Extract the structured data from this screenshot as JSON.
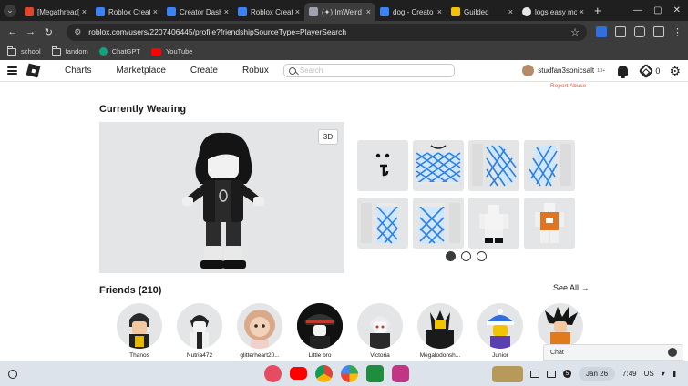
{
  "browser": {
    "tabs": [
      {
        "title": "[Megathread]",
        "favicon_color": "#e0452c",
        "active": false
      },
      {
        "title": "Roblox Creat",
        "favicon_color": "#3b82f6",
        "active": false
      },
      {
        "title": "Creator Dash",
        "favicon_color": "#3b82f6",
        "active": false
      },
      {
        "title": "Roblox Creat",
        "favicon_color": "#3b82f6",
        "active": false
      },
      {
        "title": "(✦) ImWeird",
        "favicon_color": "#9ca3af",
        "active": true
      },
      {
        "title": "dog - Creato",
        "favicon_color": "#3b82f6",
        "active": false
      },
      {
        "title": "Guilded",
        "favicon_color": "#f5c400",
        "active": false
      },
      {
        "title": "logs easy mo",
        "favicon_color": "#e8e8e8",
        "active": false
      }
    ],
    "url": "roblox.com/users/2207406445/profile?friendshipSourceType=PlayerSearch",
    "bookmarks": [
      {
        "label": "school",
        "kind": "folder"
      },
      {
        "label": "fandom",
        "kind": "folder"
      },
      {
        "label": "ChatGPT",
        "kind": "site",
        "color": "#10a37f"
      },
      {
        "label": "YouTube",
        "kind": "site",
        "color": "#ff0000"
      }
    ]
  },
  "header": {
    "nav": [
      "Charts",
      "Marketplace",
      "Create",
      "Robux"
    ],
    "search_placeholder": "Search",
    "username": "studfan3sonicsalt",
    "age_tag": "13+",
    "robux": "0"
  },
  "profile": {
    "report_label": "Report Abuse",
    "wearing_title": "Currently Wearing",
    "toggle_3d": "3D",
    "items": [
      "face-item",
      "shirt-item",
      "arm-item",
      "arm-item-2",
      "leg-item",
      "leg-item-2",
      "outfit-item",
      "outfit-item-2"
    ],
    "carousel_page": 1,
    "carousel_pages": 3,
    "friends_title": "Friends (210)",
    "see_all": "See All →",
    "friends": [
      {
        "name": "Thanos"
      },
      {
        "name": "Nutria472"
      },
      {
        "name": "glitterheart20..."
      },
      {
        "name": "Little bro"
      },
      {
        "name": "Victoria"
      },
      {
        "name": "Megalodonsh..."
      },
      {
        "name": "Junior"
      },
      {
        "name": ""
      }
    ]
  },
  "chat": {
    "label": "Chat"
  },
  "shelf": {
    "date": "Jan 26",
    "time": "7:49",
    "locale": "US",
    "notif_count": "5"
  }
}
